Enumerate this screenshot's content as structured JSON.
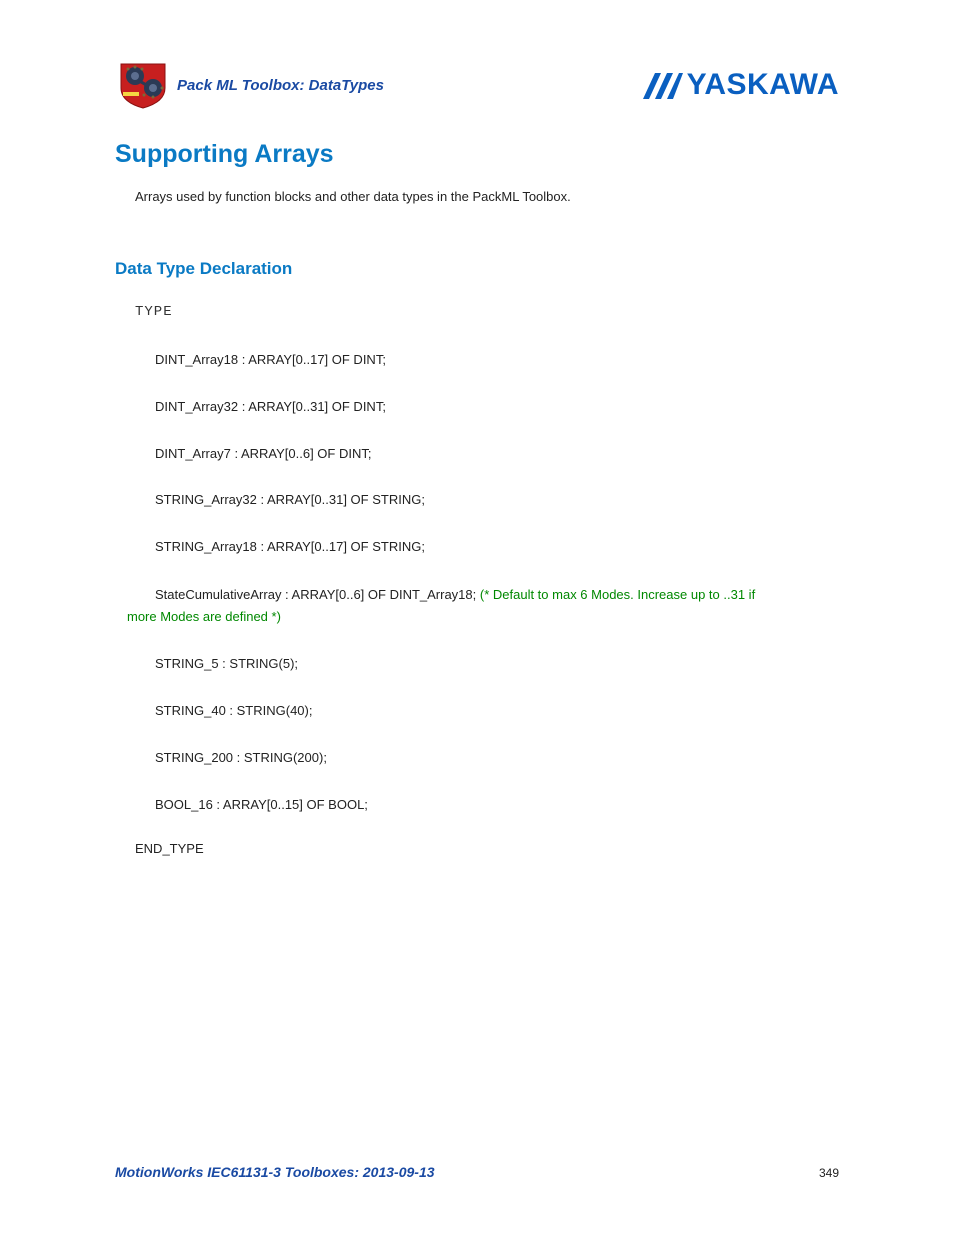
{
  "header": {
    "section_title": "Pack ML Toolbox: DataTypes",
    "brand": "YASKAWA"
  },
  "title": "Supporting Arrays",
  "intro": "Arrays used by function blocks and other data types in the PackML Toolbox.",
  "section_heading": "Data Type Declaration",
  "code": {
    "type_kw": "TYPE",
    "lines": [
      "DINT_Array18 : ARRAY[0..17] OF DINT;",
      "DINT_Array32 : ARRAY[0..31] OF DINT;",
      "DINT_Array7 : ARRAY[0..6] OF DINT;",
      "STRING_Array32 : ARRAY[0..31] OF STRING;",
      "STRING_Array18 : ARRAY[0..17] OF STRING;"
    ],
    "multi_line_prefix": "StateCumulativeArray : ARRAY[0..6] OF DINT_Array18; ",
    "multi_line_comment_a": "(* Default to max 6 Modes. Increase up to ..31 if",
    "multi_line_comment_b": "more Modes are defined *)",
    "lines_after": [
      "STRING_5 : STRING(5);",
      "STRING_40 : STRING(40);",
      "STRING_200 : STRING(200);",
      "BOOL_16 : ARRAY[0..15] OF BOOL;"
    ],
    "end_type": "END_TYPE"
  },
  "footer": {
    "title": "MotionWorks IEC61131-3 Toolboxes: 2013-09-13",
    "page": "349"
  }
}
